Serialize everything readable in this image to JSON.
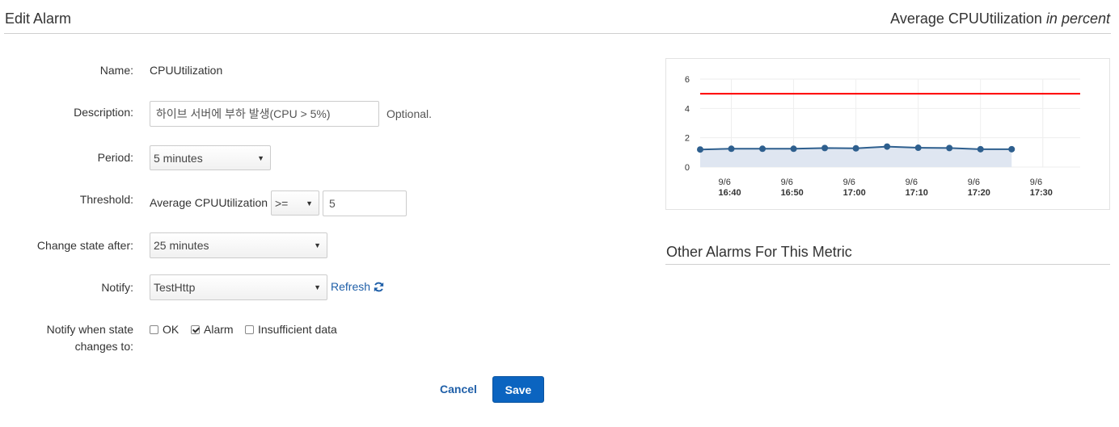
{
  "header": {
    "title": "Edit Alarm"
  },
  "chart_heading": {
    "main": "Average CPUUtilization",
    "unit": "in percent"
  },
  "form": {
    "name": {
      "label": "Name:",
      "value": "CPUUtilization"
    },
    "description": {
      "label": "Description:",
      "value": "하이브 서버에 부하 발생(CPU > 5%)",
      "hint": "Optional."
    },
    "period": {
      "label": "Period:",
      "value": "5 minutes"
    },
    "threshold": {
      "label": "Threshold:",
      "metric": "Average CPUUtilization",
      "operator": ">=",
      "value": "5"
    },
    "change_state": {
      "label": "Change state after:",
      "value": "25 minutes"
    },
    "notify": {
      "label": "Notify:",
      "value": "TestHttp",
      "refresh_label": "Refresh"
    },
    "notify_states": {
      "label_line1": "Notify when state",
      "label_line2": "changes to:",
      "options": [
        {
          "label": "OK",
          "checked": false
        },
        {
          "label": "Alarm",
          "checked": true
        },
        {
          "label": "Insufficient data",
          "checked": false
        }
      ]
    }
  },
  "actions": {
    "cancel": "Cancel",
    "save": "Save"
  },
  "other_alarms": {
    "title": "Other Alarms For This Metric"
  },
  "colors": {
    "threshold_line": "#ff0000",
    "series": "#2e5f8e",
    "series_fill": "#dfe6f1",
    "save_button": "#0b64c0",
    "link": "#1f5fa8"
  },
  "chart_data": {
    "type": "area",
    "y_ticks": [
      "0",
      "2",
      "4",
      "6"
    ],
    "ylim": [
      0,
      6
    ],
    "x_ticks": [
      {
        "day": "9/6",
        "time": "16:40"
      },
      {
        "day": "9/6",
        "time": "16:50"
      },
      {
        "day": "9/6",
        "time": "17:00"
      },
      {
        "day": "9/6",
        "time": "17:10"
      },
      {
        "day": "9/6",
        "time": "17:20"
      },
      {
        "day": "9/6",
        "time": "17:30"
      }
    ],
    "series": [
      {
        "x": [
          "16:35",
          "16:40",
          "16:45",
          "16:50",
          "16:55",
          "17:00",
          "17:05",
          "17:10",
          "17:15",
          "17:20",
          "17:25"
        ],
        "values": [
          1.2,
          1.25,
          1.25,
          1.25,
          1.3,
          1.28,
          1.4,
          1.32,
          1.3,
          1.22,
          1.22
        ]
      }
    ],
    "threshold": 5,
    "grid": true
  }
}
